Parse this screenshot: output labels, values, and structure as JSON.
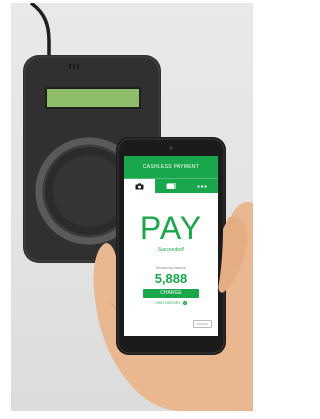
{
  "app": {
    "header_title": "CASHLESS PAYMENT",
    "tabs": [
      {
        "icon": "camera-icon",
        "active": true
      },
      {
        "icon": "card-icon",
        "active": false
      },
      {
        "icon": "more-icon",
        "active": false
      }
    ],
    "pay_label": "PAY",
    "status_text": "Succeeded!",
    "balance_label": "Remaining balance",
    "balance_value": "5,888",
    "charge_label": "CHARGE",
    "history_label": "VISIT HISTORY",
    "cancel_label": "CANCEL"
  },
  "colors": {
    "accent": "#1aa64a",
    "reader_body": "#2f302f",
    "reader_display": "#8fbc69",
    "phone_frame": "#1b1b1b",
    "background": "#e6e6e6",
    "skin": "#e9b790"
  }
}
